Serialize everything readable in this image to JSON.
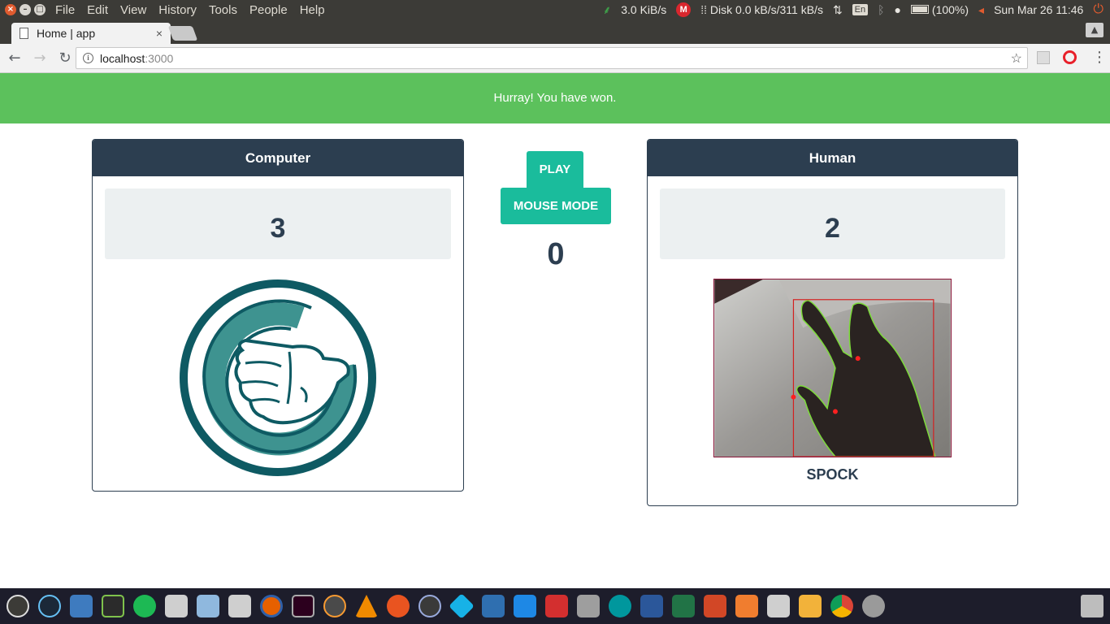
{
  "system": {
    "menu": [
      "File",
      "Edit",
      "View",
      "History",
      "Tools",
      "People",
      "Help"
    ],
    "net_speed": "3.0 KiB/s",
    "disk": "Disk 0.0 kB/s/311 kB/s",
    "lang": "En",
    "battery": "(100%)",
    "clock": "Sun Mar 26 11:46"
  },
  "browser": {
    "tab_title": "Home | app",
    "url_host": "localhost",
    "url_port": ":3000"
  },
  "page": {
    "banner": "Hurray! You have won.",
    "computer": {
      "title": "Computer",
      "score": "3"
    },
    "human": {
      "title": "Human",
      "score": "2",
      "gesture": "SPOCK"
    },
    "play_label": "PLAY",
    "mouse_mode_label": "MOUSE MODE",
    "counter": "0"
  },
  "dock": {
    "apps": [
      "ubuntu-icon",
      "steam-icon",
      "files-manager-icon",
      "system-monitor-icon",
      "spotify-icon",
      "blank-app-icon",
      "home-folder-icon",
      "blank-app-icon",
      "firefox-icon",
      "terminal-icon",
      "sublime-icon",
      "vlc-icon",
      "ubuntu-software-icon",
      "atom-icon",
      "kodi-icon",
      "network-icon",
      "sync-icon",
      "pdf-icon",
      "calculator-icon",
      "arduino-icon",
      "word-icon",
      "excel-icon",
      "powerpoint-icon",
      "store-icon",
      "blank-app-icon",
      "amazon-icon",
      "chrome-icon",
      "settings-icon",
      "trash-icon"
    ]
  },
  "colors": {
    "banner": "#5cc15c",
    "panel_header": "#2c3e50",
    "button": "#1abc9c",
    "score_bg": "#ecf0f1",
    "gesture_teal": "#0e5a63"
  }
}
